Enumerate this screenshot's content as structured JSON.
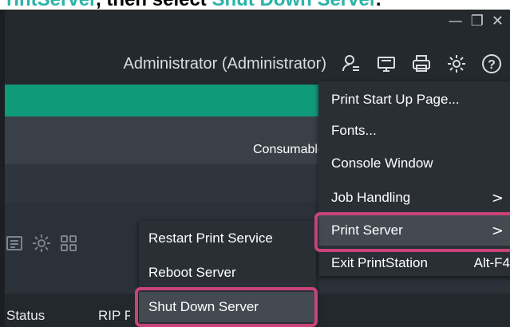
{
  "caption": {
    "part1": "rintServer",
    "part2": ", then select ",
    "part3": "Shut Down Server",
    "part4": "."
  },
  "colors": {
    "accent_teal": "#2bb3a8",
    "green_bar": "#0f9a7a",
    "highlight_border": "#c9437a",
    "menu_bg": "#2a2f35"
  },
  "window_controls": {
    "minimize": "—",
    "restore": "❐",
    "close": "✕"
  },
  "userbar": {
    "user_label": "Administrator (Administrator)",
    "icons": [
      "user-switch-icon",
      "monitor-icon",
      "printer-icon",
      "settings-icon",
      "help-icon"
    ],
    "help_glyph": "?"
  },
  "tab_partial": "Consumables",
  "table_headers": {
    "status": "Status",
    "rip": "RIP Processing"
  },
  "main_menu": {
    "items": [
      {
        "label": "Print Start Up Page..."
      },
      {
        "label": "Fonts..."
      },
      {
        "label": "Console Window"
      },
      {
        "label": "Job Handling",
        "arrow": ">"
      },
      {
        "label": "Print Server",
        "arrow": ">"
      },
      {
        "label": "Exit PrintStation",
        "shortcut": "Alt-F4"
      }
    ]
  },
  "sub_menu": {
    "items": [
      {
        "label": "Restart Print Service"
      },
      {
        "label": "Reboot Server"
      },
      {
        "label": "Shut Down Server"
      }
    ]
  }
}
